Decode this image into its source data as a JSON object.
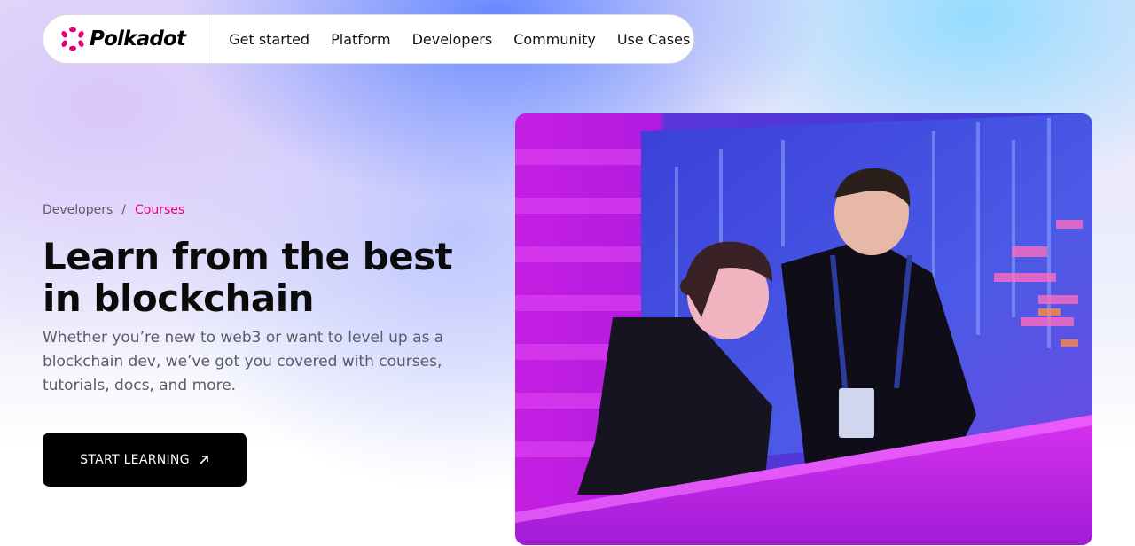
{
  "brand": {
    "name": "Polkadot",
    "icon": "polkadot-logo-icon",
    "color": "#e6007a"
  },
  "nav": {
    "items": [
      {
        "label": "Get started"
      },
      {
        "label": "Platform"
      },
      {
        "label": "Developers"
      },
      {
        "label": "Community"
      },
      {
        "label": "Use Cases"
      }
    ]
  },
  "breadcrumb": {
    "parent": "Developers",
    "separator": "/",
    "current": "Courses"
  },
  "hero": {
    "title": "Learn from the best in blockchain",
    "subtitle": "Whether you’re new to web3 or want to level up as a blockchain dev, we’ve got you covered with courses, tutorials, docs, and more.",
    "cta_label": "START LEARNING",
    "cta_icon": "arrow-up-right-icon",
    "image_icon": "hero-photo"
  },
  "colors": {
    "accent": "#e6007a",
    "cta_bg": "#000000",
    "text": "#0b0b0b"
  }
}
